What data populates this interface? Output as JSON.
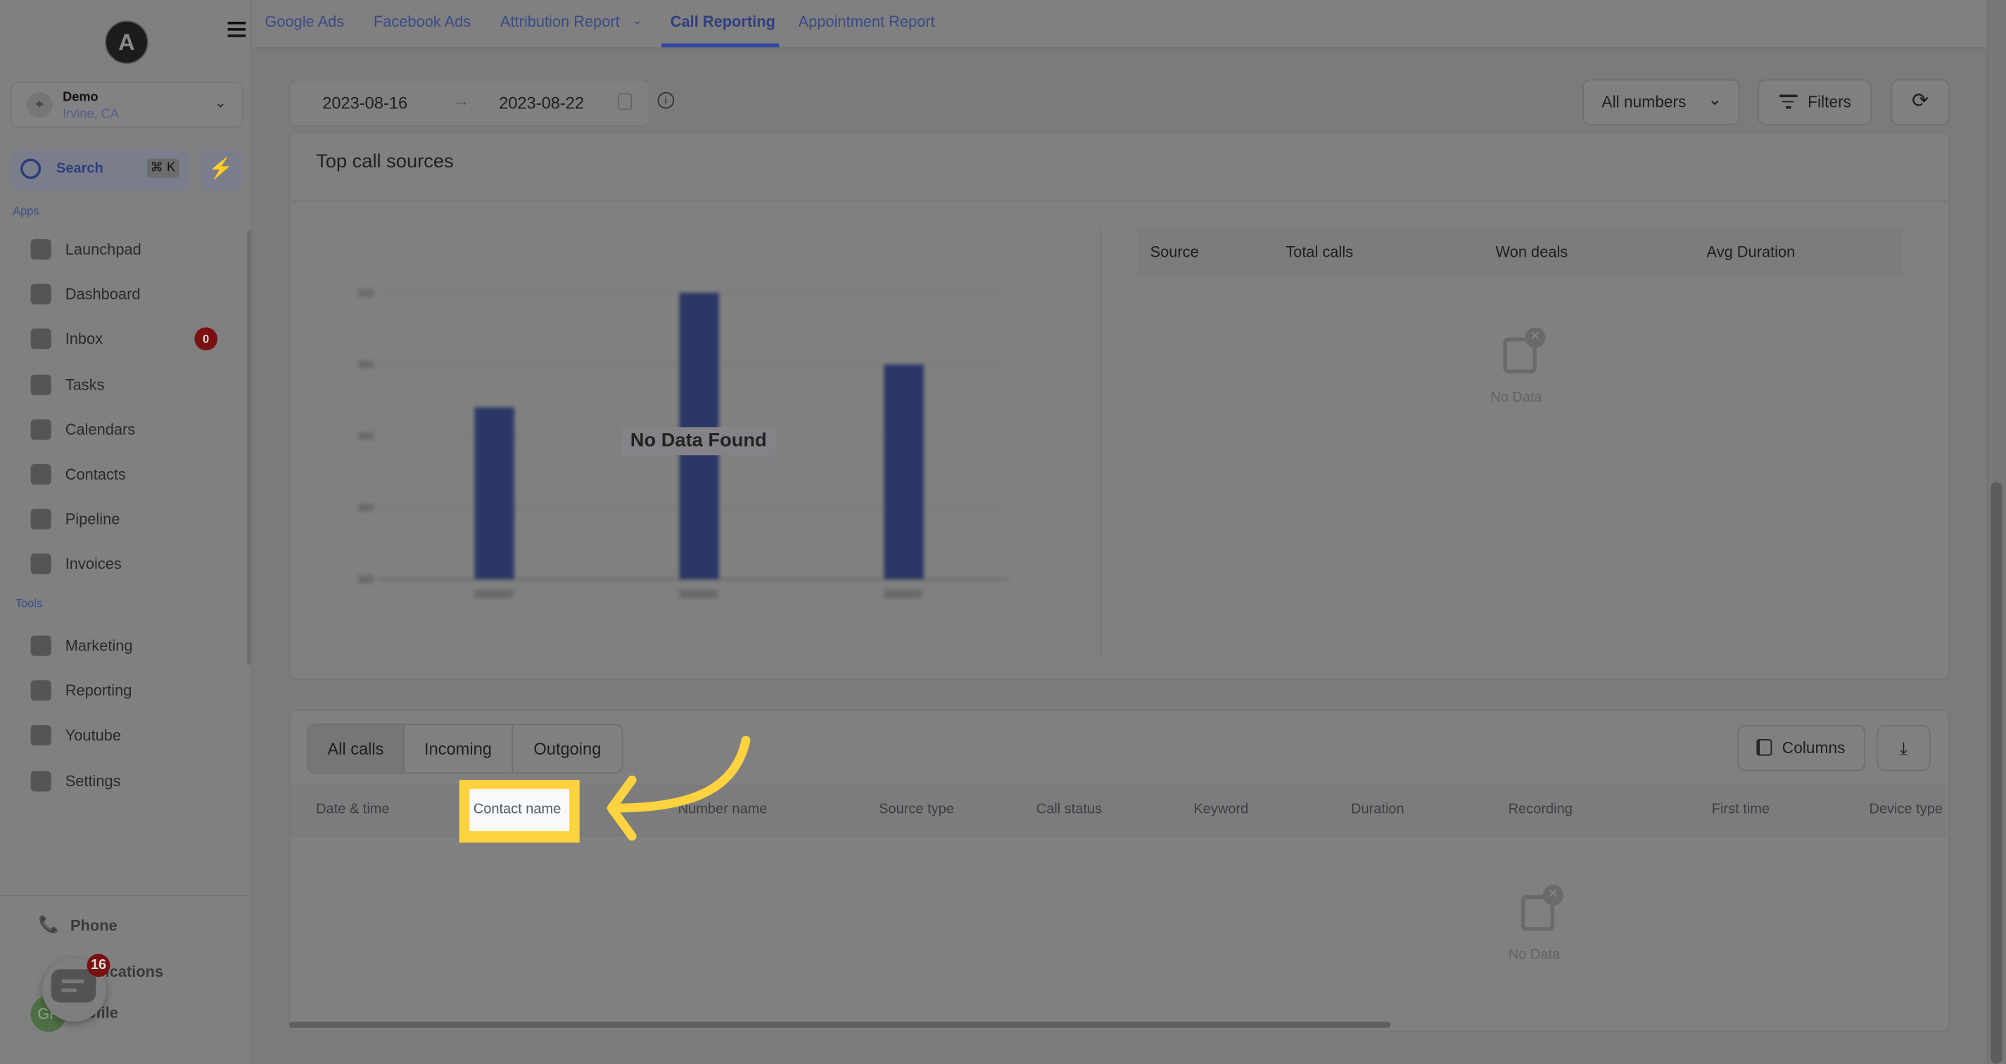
{
  "sidebar": {
    "logo_letter": "A",
    "location": {
      "name": "Demo",
      "city": "Irvine, CA"
    },
    "search": {
      "label": "Search",
      "shortcut": "⌘ K"
    },
    "apps_label": "Apps",
    "tools_label": "Tools",
    "apps": [
      {
        "label": "Launchpad",
        "icon": "rocket-icon"
      },
      {
        "label": "Dashboard",
        "icon": "dashboard-icon"
      },
      {
        "label": "Inbox",
        "icon": "inbox-icon",
        "badge": "0"
      },
      {
        "label": "Tasks",
        "icon": "tasks-icon"
      },
      {
        "label": "Calendars",
        "icon": "calendar-icon"
      },
      {
        "label": "Contacts",
        "icon": "contacts-icon"
      },
      {
        "label": "Pipeline",
        "icon": "pipeline-icon"
      },
      {
        "label": "Invoices",
        "icon": "invoice-icon"
      }
    ],
    "tools": [
      {
        "label": "Marketing",
        "icon": "megaphone-icon"
      },
      {
        "label": "Reporting",
        "icon": "pie-chart-icon"
      },
      {
        "label": "Youtube",
        "icon": "youtube-icon"
      },
      {
        "label": "Settings",
        "icon": "gear-icon"
      }
    ],
    "bottom": {
      "phone": "Phone",
      "notifications": "Notifications",
      "profile": "Profile",
      "avatar_initials": "GP",
      "chat_badge": "16"
    }
  },
  "topnav": {
    "tabs": [
      "Google Ads",
      "Facebook Ads",
      "Attribution Report",
      "Call Reporting",
      "Appointment Report"
    ],
    "active": "Call Reporting"
  },
  "toolbar": {
    "date_start": "2023-08-16",
    "date_end": "2023-08-22",
    "numbers_select": "All numbers",
    "filters": "Filters"
  },
  "top_sources": {
    "title": "Top call sources",
    "no_data_overlay": "No Data Found",
    "table_headers": [
      "Source",
      "Total calls",
      "Won deals",
      "Avg Duration"
    ],
    "empty_text": "No Data"
  },
  "chart_data": {
    "type": "bar",
    "note_visible": "No Data Found",
    "values": [
      120,
      200,
      150
    ],
    "ylim": [
      0,
      200
    ],
    "bar_color": "#2b3766"
  },
  "calls": {
    "tabs": [
      "All calls",
      "Incoming",
      "Outgoing"
    ],
    "active_tab": "All calls",
    "columns_button": "Columns",
    "headers": [
      "Date & time",
      "Contact name",
      "Number name",
      "Source type",
      "Call status",
      "Keyword",
      "Duration",
      "Recording",
      "First time",
      "Device type"
    ],
    "highlighted_header": "Contact name",
    "empty_text": "No Data"
  },
  "colors": {
    "highlight": "#ffd23f",
    "accent": "#2f47a0"
  }
}
